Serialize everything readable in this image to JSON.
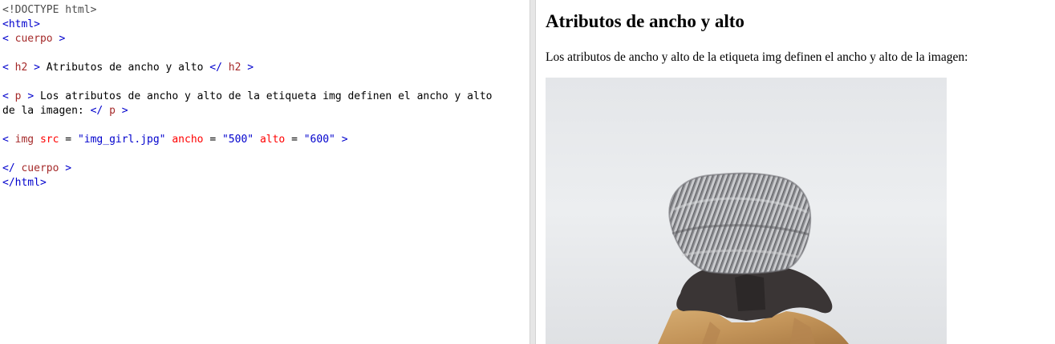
{
  "editor": {
    "line_1": {
      "doctype": "<!DOCTYPE html>"
    },
    "line_2": {
      "open": "<html>"
    },
    "line_3": {
      "lt": "<",
      "name": "cuerpo",
      "gt": ">"
    },
    "line_5": {
      "lt": "<",
      "name": "h2",
      "gt": ">",
      "text": "Atributos de ancho y alto",
      "close_lt": "</",
      "close_name": "h2",
      "close_gt": ">"
    },
    "line_7": {
      "lt": "<",
      "name": "p",
      "gt": ">",
      "text": "Los atributos de ancho y alto de la etiqueta img definen el ancho y alto"
    },
    "line_8": {
      "text": "de la imagen:",
      "close_lt": "</",
      "close_name": "p",
      "close_gt": ">"
    },
    "line_10": {
      "lt": "<",
      "name": "img",
      "attr_src": "src",
      "eq1": "=",
      "val_src": "\"img_girl.jpg\"",
      "attr_width": "ancho",
      "eq2": "=",
      "val_width": "\"500\"",
      "attr_height": "alto",
      "eq3": "=",
      "val_height": "\"600\"",
      "gt": ">"
    },
    "line_12": {
      "close_lt": "</",
      "close_name": "cuerpo",
      "close_gt": ">"
    },
    "line_13": {
      "close": "</html>"
    }
  },
  "result": {
    "heading": "Atributos de ancho y alto",
    "paragraph": "Los atributos de ancho y alto de la etiqueta img definen el ancho y alto de la imagen:",
    "image": {
      "subject": "person-with-knit-beanie"
    }
  },
  "colors": {
    "tag_bracket": "#0000cd",
    "tag_name": "#a52a2a",
    "attribute": "#ff0000",
    "attribute_value": "#0000cd",
    "doctype": "#4c4c4c"
  }
}
